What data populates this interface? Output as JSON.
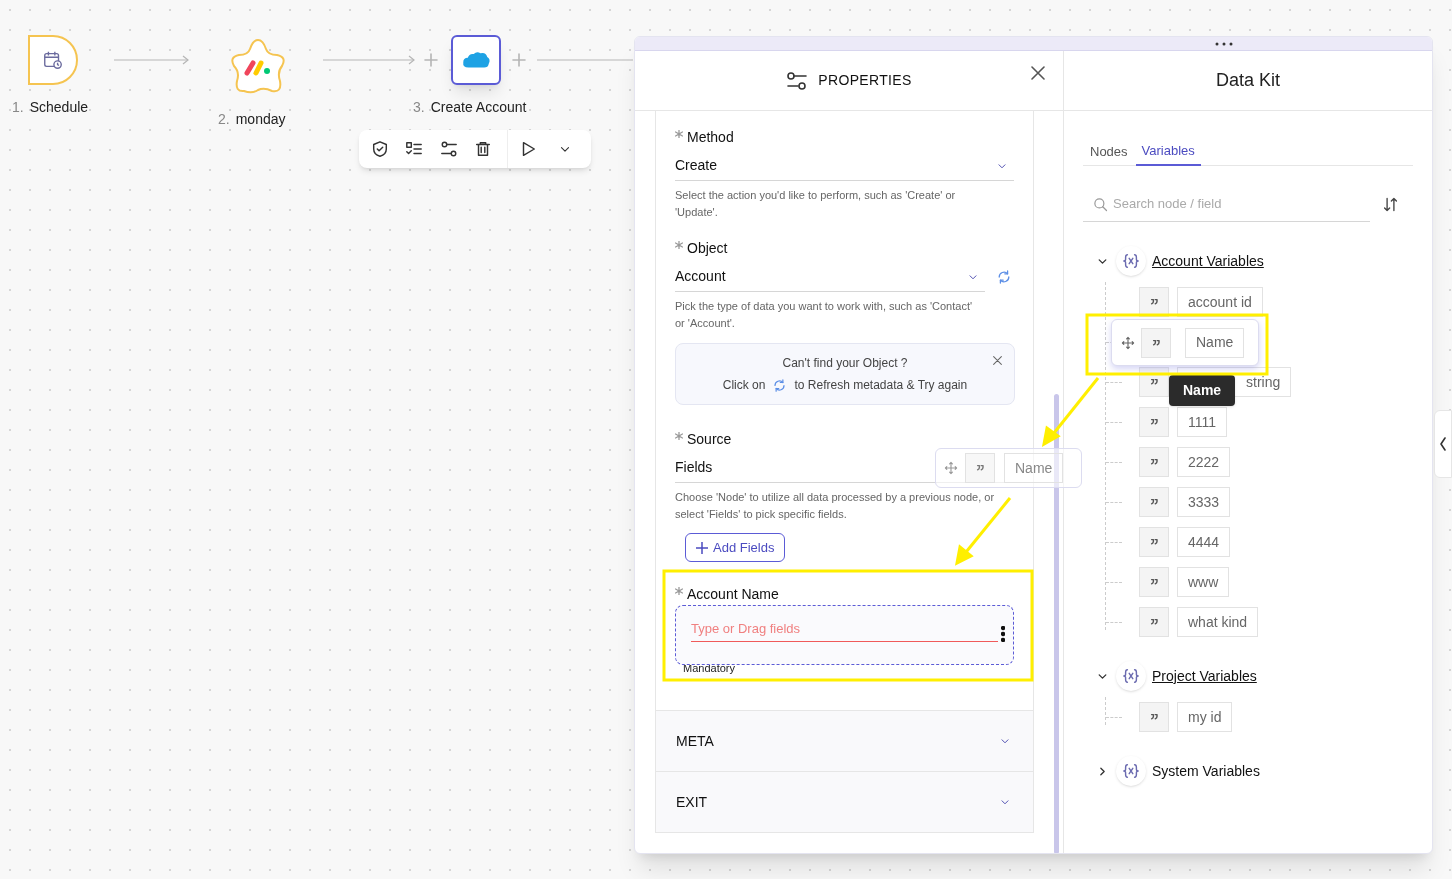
{
  "flow": {
    "nodes": [
      {
        "number": "1.",
        "label": "Schedule",
        "kind": "schedule",
        "selected": false
      },
      {
        "number": "2.",
        "label": "monday",
        "kind": "monday",
        "selected": false
      },
      {
        "number": "3.",
        "label": "Create Account",
        "kind": "salesforce",
        "selected": true
      }
    ]
  },
  "properties": {
    "title": "PROPERTIES",
    "fields": [
      {
        "kind": "select",
        "label": "Method",
        "required": true,
        "value": "Create",
        "refresh": false,
        "hint": "Select the action you'd like to perform, such as 'Create' or 'Update'."
      },
      {
        "kind": "select",
        "label": "Object",
        "required": true,
        "value": "Account",
        "refresh": true,
        "hint": "Pick the type of data you want to work with, such as 'Contact' or 'Account'."
      },
      {
        "kind": "notice",
        "title": "Can't find your Object ?",
        "before": "Click on",
        "after": "to Refresh metadata & Try again"
      },
      {
        "kind": "plain",
        "label": "Source",
        "required": true,
        "value": "Fields",
        "hint": "Choose 'Node' to utilize all data processed by a previous node, or select 'Fields' to pick specific fields."
      },
      {
        "kind": "button",
        "label": "Add Fields"
      },
      {
        "kind": "drop",
        "label": "Account Name",
        "required": true,
        "placeholder": "Type or Drag fields",
        "helper": "Mandatory"
      }
    ],
    "sections": [
      {
        "label": "META",
        "expanded": false
      },
      {
        "label": "EXIT",
        "expanded": false
      }
    ]
  },
  "data_kit": {
    "title": "Data Kit",
    "tabs": [
      {
        "label": "Nodes",
        "selected": false
      },
      {
        "label": "Variables",
        "selected": true
      }
    ],
    "search": {
      "placeholder": "Search node / field"
    },
    "groups": [
      {
        "name": "Account Variables",
        "expanded": true,
        "items": [
          {
            "value": "account id",
            "kind": "field"
          },
          {
            "value": "Name",
            "kind": "dragging"
          },
          {
            "value": "string",
            "kind": "covered"
          },
          {
            "value": "1111",
            "kind": "field"
          },
          {
            "value": "2222",
            "kind": "field"
          },
          {
            "value": "3333",
            "kind": "field"
          },
          {
            "value": "4444",
            "kind": "field"
          },
          {
            "value": "www",
            "kind": "field"
          },
          {
            "value": "what kind",
            "kind": "field"
          }
        ]
      },
      {
        "name": "Project Variables",
        "expanded": true,
        "items": [
          {
            "value": "my id",
            "kind": "field"
          }
        ]
      },
      {
        "name": "System Variables",
        "expanded": false
      }
    ]
  },
  "tooltip": "Name",
  "drag_ghost": {
    "value": "Name"
  }
}
